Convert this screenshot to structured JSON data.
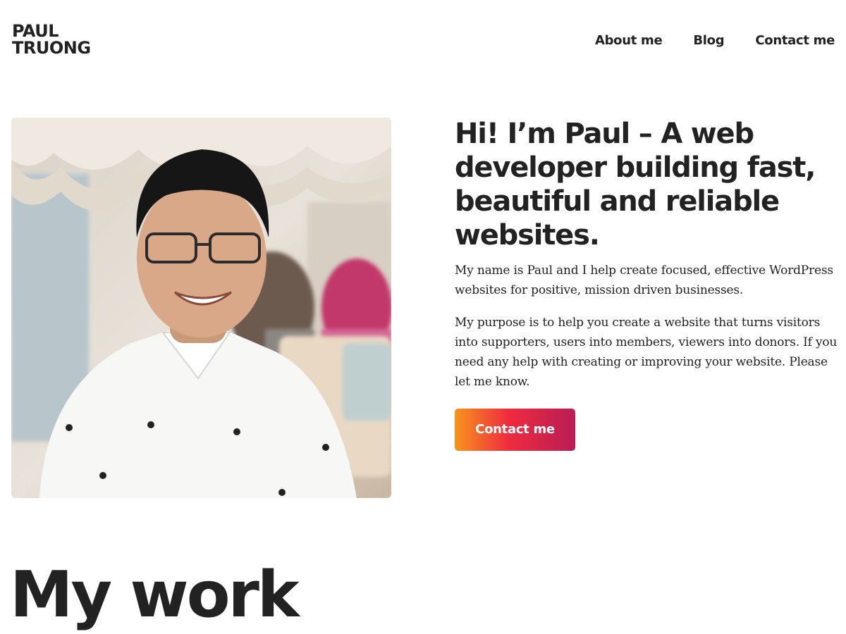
{
  "header": {
    "logo_line1": "PAUL",
    "logo_line2": "TRUONG",
    "nav": [
      {
        "label": "About me"
      },
      {
        "label": "Blog"
      },
      {
        "label": "Contact me"
      }
    ]
  },
  "hero": {
    "photo_icon": "portrait-photo",
    "heading": "Hi! I’m Paul – A web developer building fast, beautiful and reliable websites.",
    "paragraph1": "My name is Paul and I help create focused, effective WordPress websites for positive, mission driven businesses.",
    "paragraph2": "My purpose is to help you create a website that turns visitors into supporters, users into members, viewers into donors. If you need any help with creating or improving your website. Please let me know.",
    "cta_label": "Contact me"
  },
  "work": {
    "title": "My work"
  },
  "colors": {
    "text": "#222222",
    "background": "#ffffff",
    "cta_gradient_start": "#f7941d",
    "cta_gradient_mid": "#ef2b3f",
    "cta_gradient_end": "#b81d55"
  }
}
